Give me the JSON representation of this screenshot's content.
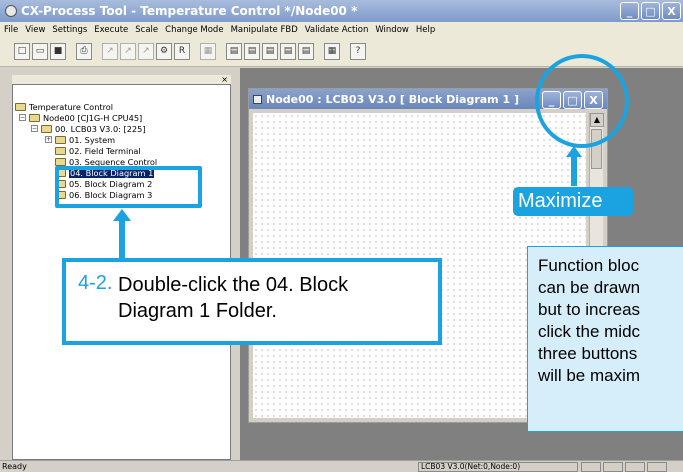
{
  "window": {
    "title": "CX-Process Tool - Temperature Control */Node00 *",
    "minimize_glyph": "_",
    "maximize_glyph": "□",
    "close_glyph": "X"
  },
  "menu": [
    "File",
    "View",
    "Settings",
    "Execute",
    "Scale",
    "Change Mode",
    "Manipulate FBD",
    "Validate Action",
    "Window",
    "Help"
  ],
  "tree": {
    "close_glyph": "×",
    "items": [
      "Temperature Control",
      "Node00 [CJ1G-H CPU45]",
      "00. LCB03 V3.0: [225]",
      "01. System",
      "02. Field Terminal",
      "03. Sequence Control",
      "04. Block Diagram 1",
      "05. Block Diagram 2",
      "06. Block Diagram 3"
    ]
  },
  "child": {
    "title": "Node00 : LCB03 V3.0 [ Block Diagram 1 ]"
  },
  "status": {
    "text": "Ready",
    "node_info": "LCB03 V3.0(Net:0,Node:0)"
  },
  "callouts": {
    "step": {
      "number": "4-2.",
      "text": "Double-click the 04. Block Diagram 1 Folder."
    },
    "maximize": "Maximize",
    "note": [
      "Function bloc",
      "can be drawn",
      "but to increas",
      "click the midc",
      "three buttons",
      "will be maxim"
    ]
  }
}
